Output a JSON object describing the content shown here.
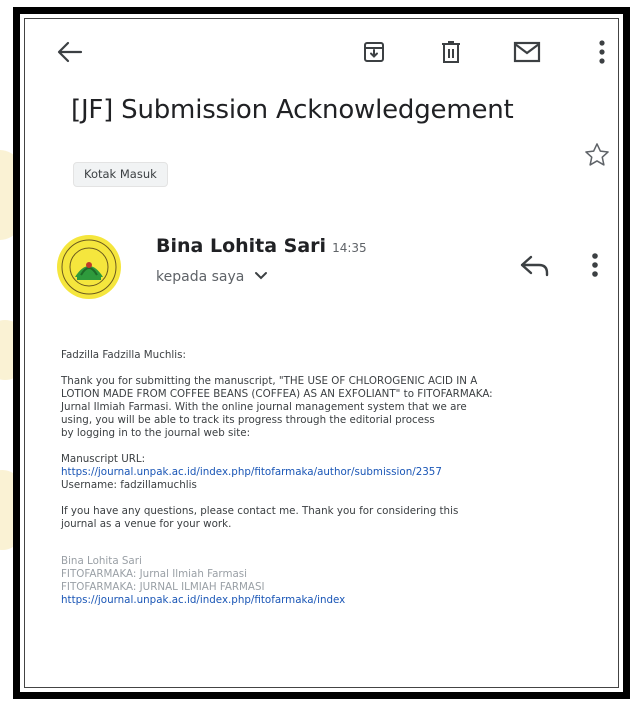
{
  "email": {
    "subject": "[JF] Submission Acknowledgement",
    "label": "Kotak Masuk",
    "sender": {
      "name": "Bina Lohita Sari",
      "time": "14:35",
      "recipient": "kepada saya"
    },
    "greeting": "Fadzilla Fadzilla Muchlis:",
    "paragraph_lines": [
      "Thank you for submitting the manuscript, \"THE USE OF CHLOROGENIC ACID IN A",
      "LOTION MADE FROM COFFEE BEANS (COFFEA) AS AN EXFOLIANT\" to FITOFARMAKA:",
      "Jurnal Ilmiah Farmasi. With the online journal management system that we are",
      "using, you will be able to track its progress through the editorial process",
      "by logging in to the journal web site:"
    ],
    "manuscript_url_label": "Manuscript URL:",
    "manuscript_url": "https://journal.unpak.ac.id/index.php/fitofarmaka/author/submission/2357",
    "username": "Username: fadzillamuchlis",
    "closing_lines": [
      "If you have any questions, please contact me. Thank you for considering this",
      "journal as a venue for your work."
    ],
    "signature": {
      "name": "Bina Lohita Sari",
      "journal": "FITOFARMAKA: Jurnal Ilmiah Farmasi",
      "journal_upper": "FITOFARMAKA: JURNAL ILMIAH FARMASI",
      "url": "https://journal.unpak.ac.id/index.php/fitofarmaka/index"
    }
  },
  "icons": {
    "back": "arrow-left-icon",
    "archive": "archive-icon",
    "delete": "trash-icon",
    "mark_unread": "mail-icon",
    "more": "more-vert-icon",
    "star": "star-outline-icon",
    "reply": "reply-icon"
  },
  "colors": {
    "link": "#1a56b6",
    "avatar_bg": "#f5e63d",
    "avatar_green": "#2e9a3c",
    "signature": "#9aa0a6"
  }
}
